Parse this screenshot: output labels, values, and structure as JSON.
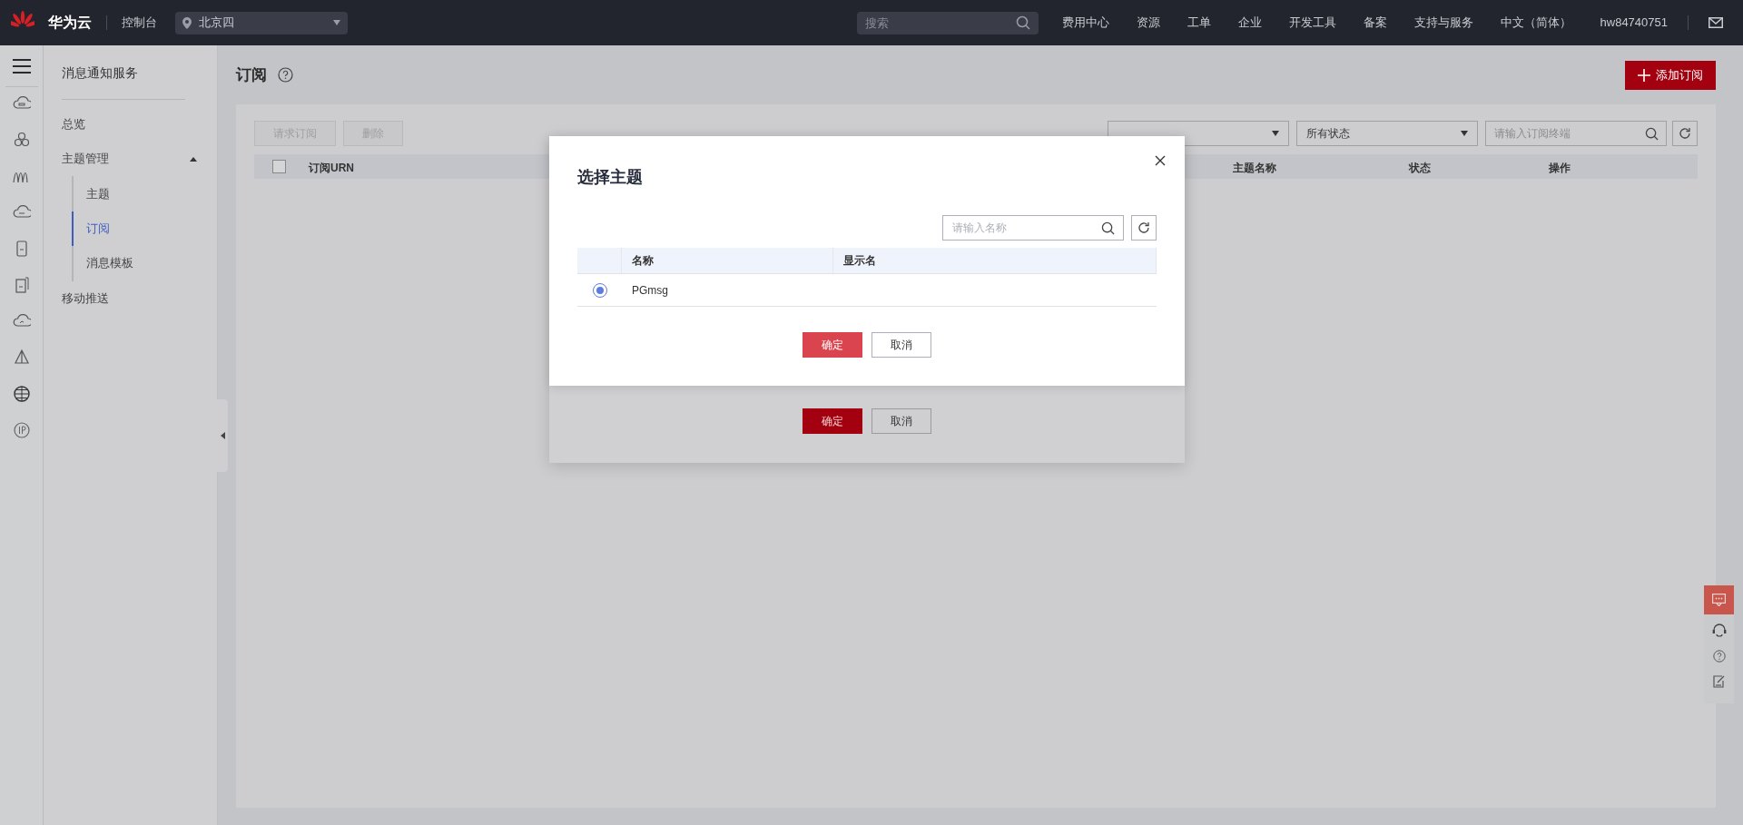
{
  "top_bar": {
    "brand": "华为云",
    "console": "控制台",
    "region": "北京四",
    "search": {
      "placeholder": "搜索"
    },
    "menu": [
      "费用中心",
      "资源",
      "工单",
      "企业",
      "开发工具",
      "备案",
      "支持与服务",
      "中文（简体）"
    ],
    "user": "hw84740751"
  },
  "sidebar": {
    "title": "消息通知服务",
    "items": [
      {
        "label": "总览",
        "selected": false
      },
      {
        "label": "主题管理",
        "selected": false,
        "expanded": true,
        "children": [
          {
            "label": "主题",
            "selected": false
          },
          {
            "label": "订阅",
            "selected": true
          },
          {
            "label": "消息模板",
            "selected": false
          }
        ]
      },
      {
        "label": "移动推送",
        "selected": false
      }
    ]
  },
  "page": {
    "title": "订阅",
    "add_button": "添加订阅",
    "actions": [
      {
        "label": "请求订阅",
        "disabled": true
      },
      {
        "label": "删除",
        "disabled": true
      }
    ],
    "filters": [
      {
        "value": "所有状态"
      }
    ],
    "search": {
      "placeholder": "请输入订阅终端"
    },
    "table": {
      "header_checkbox": {
        "checked": false
      },
      "columns": [
        "订阅URN",
        "主题名称",
        "状态",
        "操作"
      ]
    }
  },
  "lower_dialog": {
    "buttons": [
      {
        "label": "确定",
        "kind": "primary"
      },
      {
        "label": "取消",
        "kind": "secondary"
      }
    ]
  },
  "dialog": {
    "title": "选择主题",
    "search": {
      "placeholder": "请输入名称"
    },
    "table": {
      "columns": [
        "名称",
        "显示名"
      ],
      "rows": [
        {
          "name": "PGmsg",
          "selected": true
        }
      ]
    },
    "buttons": [
      {
        "label": "确定",
        "kind": "primary"
      },
      {
        "label": "取消",
        "kind": "secondary"
      }
    ]
  }
}
